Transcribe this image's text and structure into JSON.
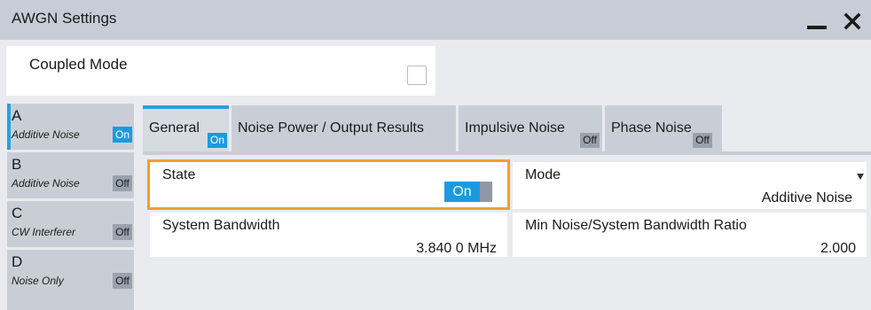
{
  "window": {
    "title": "AWGN Settings"
  },
  "coupled_mode": {
    "label": "Coupled Mode",
    "checked": false
  },
  "sidebar": {
    "items": [
      {
        "letter": "A",
        "subtitle": "Additive Noise",
        "status": "On"
      },
      {
        "letter": "B",
        "subtitle": "Additive Noise",
        "status": "Off"
      },
      {
        "letter": "C",
        "subtitle": "CW Interferer",
        "status": "Off"
      },
      {
        "letter": "D",
        "subtitle": "Noise Only",
        "status": "Off"
      }
    ],
    "selected_index": 0
  },
  "tabs": [
    {
      "label": "General",
      "status": "On"
    },
    {
      "label": "Noise Power / Output Results",
      "status": ""
    },
    {
      "label": "Impulsive Noise",
      "status": "Off"
    },
    {
      "label": "Phase Noise",
      "status": "Off"
    }
  ],
  "fields": {
    "state": {
      "label": "State",
      "value": "On"
    },
    "mode": {
      "label": "Mode",
      "value": "Additive Noise"
    },
    "system_bandwidth": {
      "label": "System Bandwidth",
      "value": "3.840 0 MHz"
    },
    "min_noise_ratio": {
      "label": "Min Noise/System Bandwidth Ratio",
      "value": "2.000"
    }
  },
  "colors": {
    "accent": "#2a9fe0",
    "on": "#1a9be0",
    "focus": "#f0a030",
    "titlebar": "#c7ccd6"
  },
  "icons": {
    "minimize": "minimize-icon",
    "close": "close-icon",
    "dropdown": "chevron-down-icon"
  }
}
